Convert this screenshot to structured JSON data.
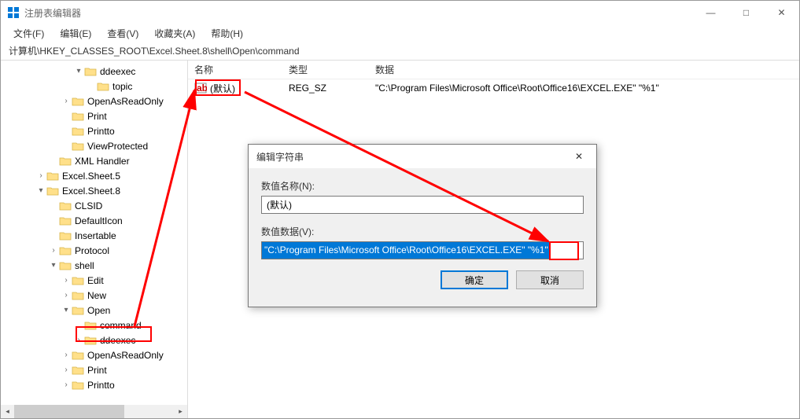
{
  "window": {
    "title": "注册表编辑器",
    "min": "—",
    "max": "□",
    "close": "✕"
  },
  "menu": {
    "file": "文件(F)",
    "edit": "编辑(E)",
    "view": "查看(V)",
    "favorites": "收藏夹(A)",
    "help": "帮助(H)"
  },
  "address": "计算机\\HKEY_CLASSES_ROOT\\Excel.Sheet.8\\shell\\Open\\command",
  "tree": {
    "items": [
      {
        "indent": 4,
        "chev": "▾",
        "label": "ddeexec"
      },
      {
        "indent": 5,
        "chev": "",
        "label": "topic"
      },
      {
        "indent": 3,
        "chev": "›",
        "label": "OpenAsReadOnly"
      },
      {
        "indent": 3,
        "chev": "",
        "label": "Print"
      },
      {
        "indent": 3,
        "chev": "",
        "label": "Printto"
      },
      {
        "indent": 3,
        "chev": "",
        "label": "ViewProtected"
      },
      {
        "indent": 2,
        "chev": "",
        "label": "XML Handler"
      },
      {
        "indent": 1,
        "chev": "›",
        "label": "Excel.Sheet.5"
      },
      {
        "indent": 1,
        "chev": "▾",
        "label": "Excel.Sheet.8"
      },
      {
        "indent": 2,
        "chev": "",
        "label": "CLSID"
      },
      {
        "indent": 2,
        "chev": "",
        "label": "DefaultIcon"
      },
      {
        "indent": 2,
        "chev": "",
        "label": "Insertable"
      },
      {
        "indent": 2,
        "chev": "›",
        "label": "Protocol"
      },
      {
        "indent": 2,
        "chev": "▾",
        "label": "shell"
      },
      {
        "indent": 3,
        "chev": "›",
        "label": "Edit"
      },
      {
        "indent": 3,
        "chev": "›",
        "label": "New"
      },
      {
        "indent": 3,
        "chev": "▾",
        "label": "Open"
      },
      {
        "indent": 4,
        "chev": "",
        "label": "command"
      },
      {
        "indent": 4,
        "chev": "›",
        "label": "ddeexec"
      },
      {
        "indent": 3,
        "chev": "›",
        "label": "OpenAsReadOnly"
      },
      {
        "indent": 3,
        "chev": "›",
        "label": "Print"
      },
      {
        "indent": 3,
        "chev": "›",
        "label": "Printto"
      }
    ]
  },
  "list": {
    "headers": {
      "name": "名称",
      "type": "类型",
      "data": "数据"
    },
    "col_w": {
      "name": 120,
      "type": 110,
      "data": 520
    },
    "rows": [
      {
        "icon": "ab",
        "name": "(默认)",
        "type": "REG_SZ",
        "data": "\"C:\\Program Files\\Microsoft Office\\Root\\Office16\\EXCEL.EXE\" \"%1\""
      }
    ]
  },
  "dialog": {
    "title": "编辑字符串",
    "name_label": "数值名称(N):",
    "name_value": "(默认)",
    "data_label": "数值数据(V):",
    "data_value": "\"C:\\Program Files\\Microsoft Office\\Root\\Office16\\EXCEL.EXE\" \"%1\"",
    "ok": "确定",
    "cancel": "取消",
    "close": "✕"
  }
}
